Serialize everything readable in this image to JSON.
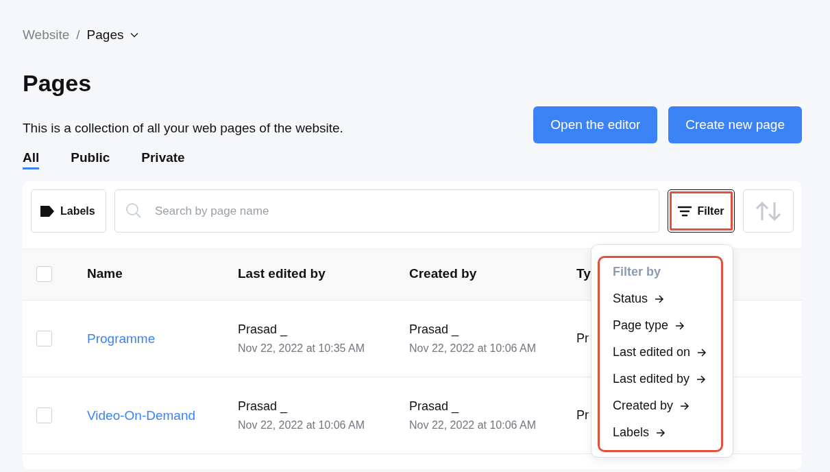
{
  "breadcrumb": {
    "parent": "Website",
    "separator": "/",
    "current": "Pages"
  },
  "title": "Pages",
  "description": "This is a collection of all your web pages of the website.",
  "buttons": [
    "Open the editor",
    "Create new page"
  ],
  "tabs": [
    {
      "label": "All",
      "selected": true
    },
    {
      "label": "Public",
      "selected": false
    },
    {
      "label": "Private",
      "selected": false
    }
  ],
  "toolbar": {
    "labels_button": "Labels",
    "search": {
      "placeholder": "Search by page name"
    },
    "filter_button": {
      "label": "Filter",
      "highlighted": true
    }
  },
  "table": {
    "columns": [
      "Name",
      "Last edited by",
      "Created by",
      "Ty"
    ],
    "all_checked": false,
    "rows": [
      {
        "checked": false,
        "name": "Programme",
        "last_edited_by": "Prasad _",
        "last_edited_on": "Nov 22, 2022 at 10:35 AM",
        "created_by": "Prasad _",
        "created_on": "Nov 22, 2022 at 10:06 AM",
        "column_4": "Pr"
      },
      {
        "checked": false,
        "name": "Video-On-Demand",
        "last_edited_by": "Prasad _",
        "last_edited_on": "Nov 22, 2022 at 10:06 AM",
        "created_by": "Prasad _",
        "created_on": "Nov 22, 2022 at 10:06 AM",
        "column_4": "Pr"
      }
    ]
  },
  "filter_menu": {
    "heading": "Filter by",
    "highlighted": true,
    "items": [
      "Status",
      "Page type",
      "Last edited on",
      "Last edited by",
      "Created by",
      "Labels"
    ]
  }
}
